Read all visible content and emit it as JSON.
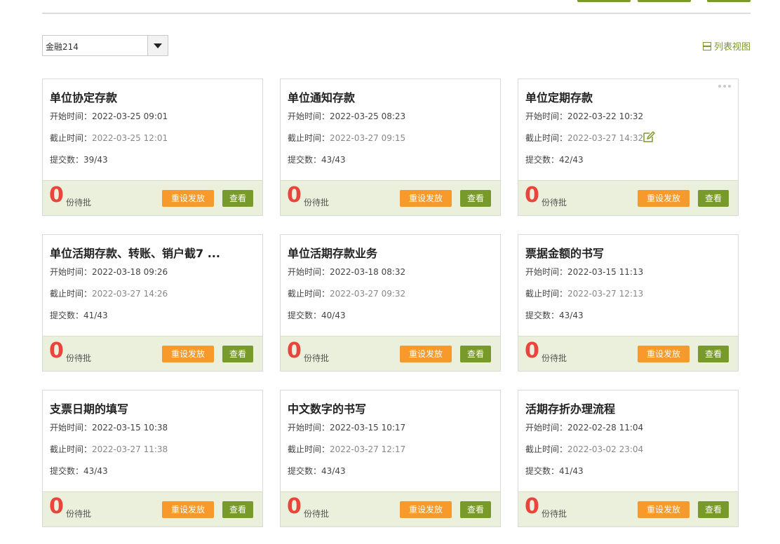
{
  "filter": {
    "selected_class": "金融214"
  },
  "view_toggle": {
    "label": "列表视图"
  },
  "labels": {
    "start": "开始时间：",
    "end": "截止时间：",
    "count": "提交数：",
    "pending_suffix": "份待批",
    "reset_button": "重设发放",
    "view_button": "查看"
  },
  "colors": {
    "accent_green": "#7a9a2a",
    "reset_orange": "#f79a2b",
    "pending_red": "#e8453c",
    "footer_bg": "#eaf0db"
  },
  "cards": [
    {
      "title": "单位协定存款",
      "start": "2022-03-25 09:01",
      "end": "2022-03-25 12:01",
      "count": "39/43",
      "pending": "0"
    },
    {
      "title": "单位通知存款",
      "start": "2022-03-25 08:23",
      "end": "2022-03-27 09:15",
      "count": "43/43",
      "pending": "0"
    },
    {
      "title": "单位定期存款",
      "start": "2022-03-22 10:32",
      "end": "2022-03-27 14:32",
      "count": "42/43",
      "pending": "0",
      "has_menu": true,
      "has_edit": true
    },
    {
      "title": "单位活期存款、转账、销户截7 ...",
      "start": "2022-03-18 09:26",
      "end": "2022-03-27 14:26",
      "count": "41/43",
      "pending": "0"
    },
    {
      "title": "单位活期存款业务",
      "start": "2022-03-18 08:32",
      "end": "2022-03-27 09:32",
      "count": "40/43",
      "pending": "0"
    },
    {
      "title": "票据金额的书写",
      "start": "2022-03-15 11:13",
      "end": "2022-03-27 12:13",
      "count": "43/43",
      "pending": "0"
    },
    {
      "title": "支票日期的填写",
      "start": "2022-03-15 10:38",
      "end": "2022-03-27 11:38",
      "count": "43/43",
      "pending": "0"
    },
    {
      "title": "中文数字的书写",
      "start": "2022-03-15 10:17",
      "end": "2022-03-27 12:17",
      "count": "43/43",
      "pending": "0"
    },
    {
      "title": "活期存折办理流程",
      "start": "2022-02-28 11:04",
      "end": "2022-03-02 23:04",
      "count": "41/43",
      "pending": "0"
    }
  ]
}
